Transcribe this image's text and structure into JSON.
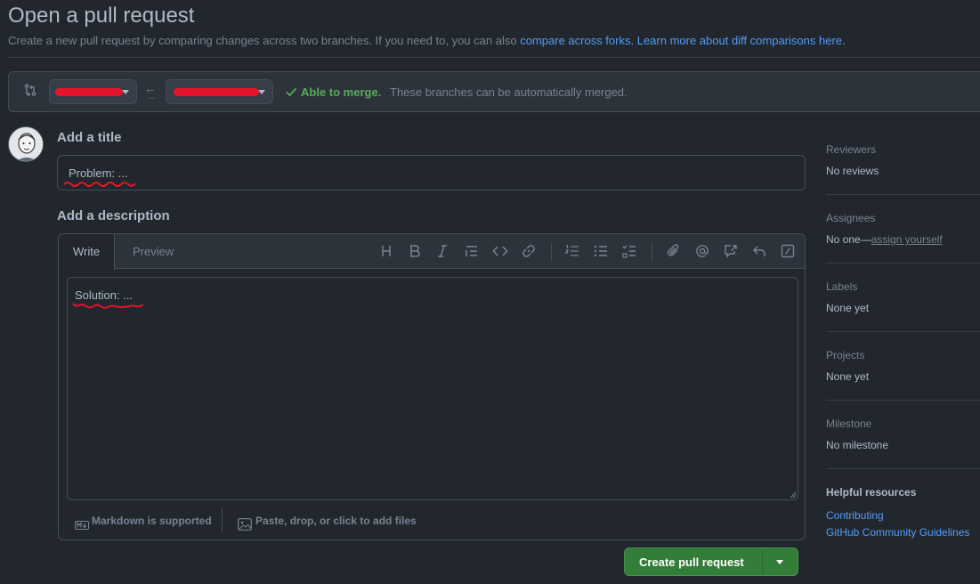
{
  "header": {
    "title": "Open a pull request",
    "subtitle": "Create a new pull request by comparing changes across two branches. If you need to, you can also ",
    "link_forks": "compare across forks.",
    "link_learn": "Learn more about diff comparisons here."
  },
  "compare": {
    "icon": "git-compare-icon",
    "base_branch": "",
    "head_branch": "",
    "merge_status": "Able to merge.",
    "merge_message": "These branches can be automatically merged.",
    "merge_color": "#57ab5a"
  },
  "form": {
    "title_label": "Add a title",
    "title_value": "Problem: ...",
    "description_label": "Add a description",
    "tabs": [
      "Write",
      "Preview"
    ],
    "toolbar": [
      "heading-icon",
      "bold-icon",
      "italic-icon",
      "quote-icon",
      "code-icon",
      "link-icon",
      "ordered-list-icon",
      "unordered-list-icon",
      "task-list-icon",
      "attach-icon",
      "mention-icon",
      "cross-reference-icon",
      "reply-icon",
      "slash-command-icon"
    ],
    "description_value": "Solution: ...",
    "markdown_note": "Markdown is supported",
    "attach_note": "Paste, drop, or click to add files",
    "submit_label": "Create pull request"
  },
  "sidebar": {
    "reviewers": {
      "label": "Reviewers",
      "value": "No reviews"
    },
    "assignees": {
      "label": "Assignees",
      "value": "No one—",
      "link": "assign yourself"
    },
    "labels": {
      "label": "Labels",
      "value": "None yet"
    },
    "projects": {
      "label": "Projects",
      "value": "None yet"
    },
    "milestone": {
      "label": "Milestone",
      "value": "No milestone"
    },
    "resources": {
      "label": "Helpful resources",
      "links": [
        "Contributing",
        "GitHub Community Guidelines"
      ]
    }
  },
  "colors": {
    "background": "#22272e",
    "accent": "#539bf5",
    "primary_button": "#347d39",
    "annotation_red": "#e5132b"
  }
}
